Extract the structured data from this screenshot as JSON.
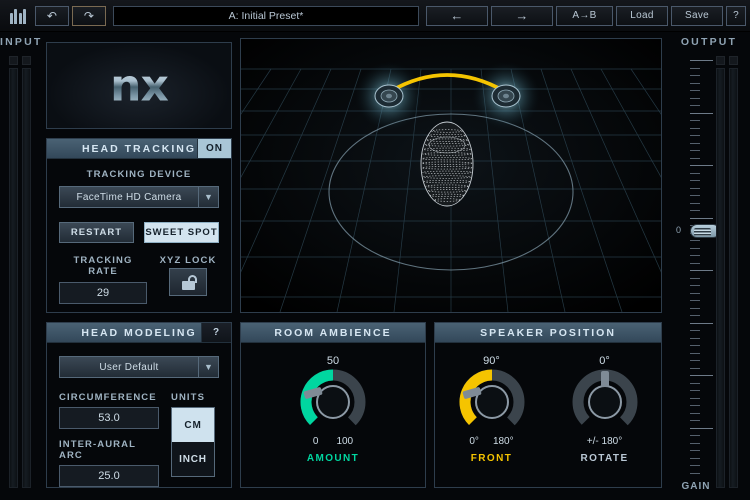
{
  "toolbar": {
    "logo": "waves-logo",
    "undo_label": "↶",
    "redo_label": "↷",
    "preset_name": "A: Initial Preset*",
    "prev_label": "←",
    "next_label": "→",
    "ab_label": "A→B",
    "load_label": "Load",
    "save_label": "Save",
    "help_label": "?"
  },
  "input_rail": {
    "label": "INPUT"
  },
  "output_rail": {
    "label": "OUTPUT",
    "gain_label": "GAIN",
    "fader_value": "0"
  },
  "logo_panel": {
    "text": "nx"
  },
  "head_tracking": {
    "title": "HEAD TRACKING",
    "toggle_label": "ON",
    "toggle_state": "on",
    "device_label": "TRACKING DEVICE",
    "device_value": "FaceTime HD Camera",
    "restart_label": "RESTART",
    "sweet_spot_label": "SWEET SPOT",
    "sweet_spot_active": true,
    "rate_label": "TRACKING RATE",
    "rate_value": "29",
    "xyz_label": "XYZ LOCK",
    "xyz_state": "unlocked"
  },
  "head_modeling": {
    "title": "HEAD MODELING",
    "help_label": "?",
    "profile_value": "User Default",
    "circumference_label": "CIRCUMFERENCE",
    "circumference_value": "53.0",
    "interaural_label": "INTER-AURAL  ARC",
    "interaural_value": "25.0",
    "units_label": "UNITS",
    "unit_cm": "CM",
    "unit_inch": "INCH",
    "unit_selected": "CM"
  },
  "room_ambience": {
    "title": "ROOM AMBIENCE",
    "knob": {
      "value": "50",
      "min": "0",
      "max": "100",
      "name": "AMOUNT",
      "color": "#00d6a0",
      "percent": 50
    }
  },
  "speaker_position": {
    "title": "SPEAKER POSITION",
    "front": {
      "value": "90°",
      "min": "0°",
      "max": "180°",
      "name": "FRONT",
      "color": "#f5c400",
      "percent": 50
    },
    "rotate": {
      "value": "0°",
      "range": "+/- 180°",
      "name": "ROTATE",
      "color": "#8a99a6",
      "percent": 0
    }
  },
  "view3d": {
    "name": "3d-room-visualization",
    "elements": [
      "grid-floor",
      "listening-ellipse",
      "left-speaker",
      "right-speaker",
      "speaker-arc",
      "wireframe-head"
    ],
    "arc_color": "#f5c400"
  }
}
